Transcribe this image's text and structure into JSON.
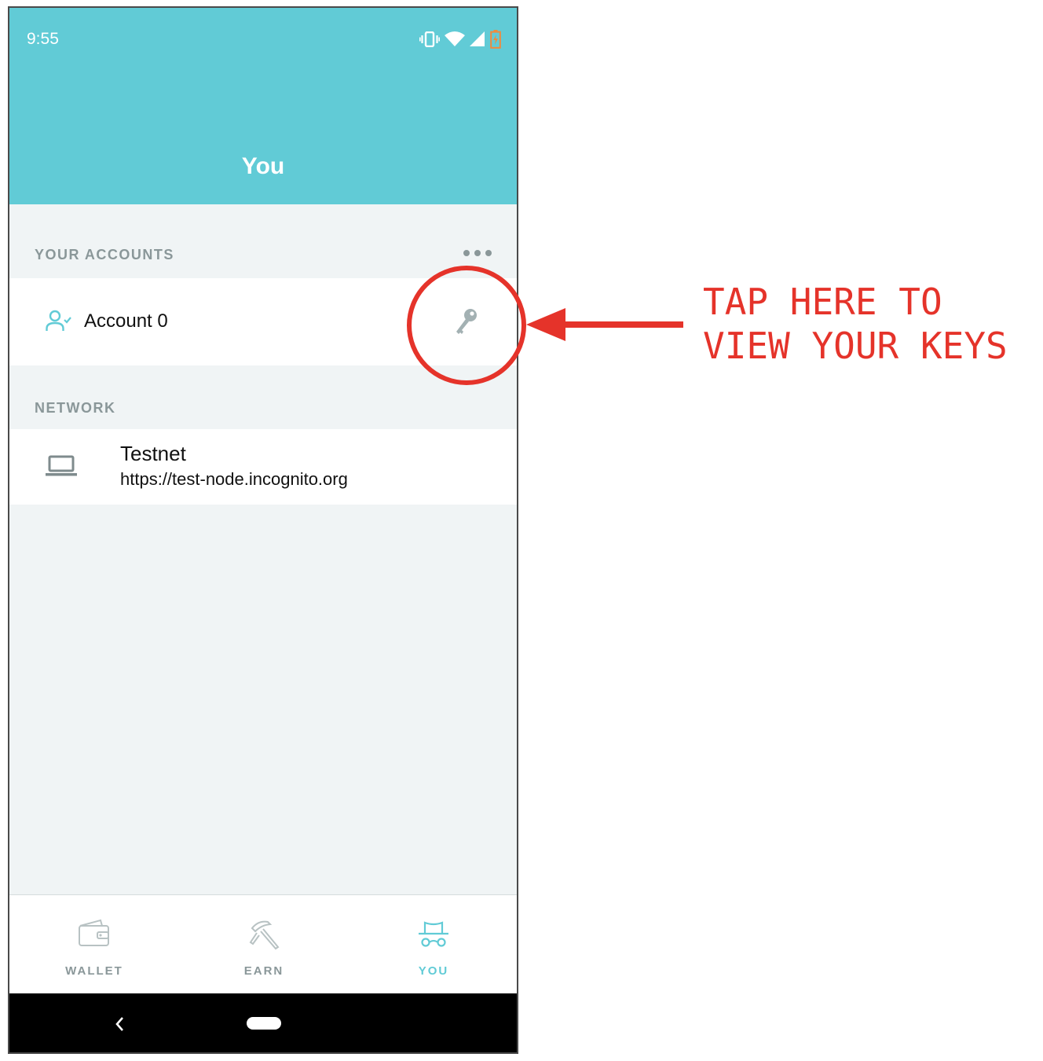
{
  "status_bar": {
    "time": "9:55",
    "icons": [
      "vibrate-icon",
      "wifi-icon",
      "signal-icon",
      "battery-icon"
    ]
  },
  "header": {
    "title": "You"
  },
  "accounts_section": {
    "label": "YOUR ACCOUNTS",
    "more_icon": "more-horizontal-icon",
    "accounts": [
      {
        "name": "Account 0",
        "icon": "user-check-icon",
        "action_icon": "key-icon"
      }
    ]
  },
  "network_section": {
    "label": "NETWORK",
    "network": {
      "name": "Testnet",
      "url": "https://test-node.incognito.org",
      "icon": "laptop-icon"
    }
  },
  "tabbar": {
    "tabs": [
      {
        "label": "WALLET",
        "icon": "wallet-icon",
        "active": false
      },
      {
        "label": "EARN",
        "icon": "pickaxe-icon",
        "active": false
      },
      {
        "label": "YOU",
        "icon": "incognito-icon",
        "active": true
      }
    ]
  },
  "nav_bar": {
    "icons": [
      "back-chevron-icon",
      "home-pill-icon"
    ]
  },
  "annotation": {
    "line1": "TAP HERE TO",
    "line2": "VIEW YOUR KEYS"
  },
  "colors": {
    "header": "#61cbd6",
    "accent": "#61cbd6",
    "background": "#f0f4f5",
    "muted_text": "#8a9799",
    "annotation": "#e5332a"
  }
}
